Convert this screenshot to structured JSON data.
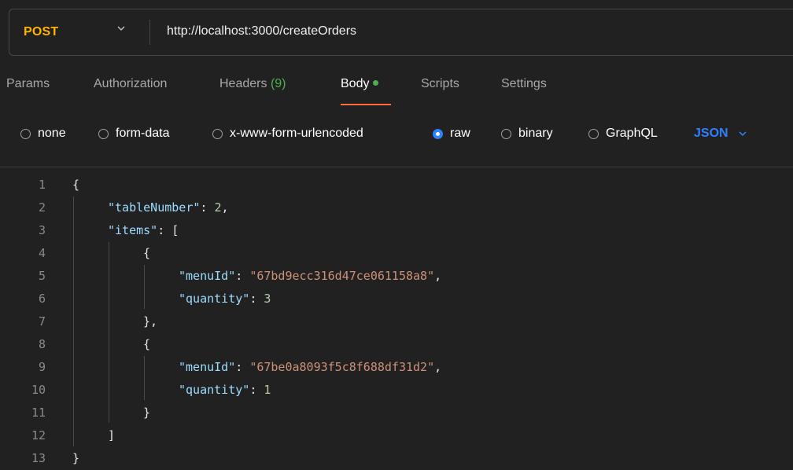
{
  "request": {
    "method": "POST",
    "url": "http://localhost:3000/createOrders"
  },
  "tabs": [
    {
      "label": "Params"
    },
    {
      "label": "Authorization"
    },
    {
      "label": "Headers",
      "count": "(9)"
    },
    {
      "label": "Body",
      "active": true
    },
    {
      "label": "Scripts"
    },
    {
      "label": "Settings"
    }
  ],
  "body_types": [
    {
      "label": "none",
      "selected": false
    },
    {
      "label": "form-data",
      "selected": false
    },
    {
      "label": "x-www-form-urlencoded",
      "selected": false
    },
    {
      "label": "raw",
      "selected": true
    },
    {
      "label": "binary",
      "selected": false
    },
    {
      "label": "GraphQL",
      "selected": false
    }
  ],
  "format": "JSON",
  "editor": {
    "line_numbers": [
      "1",
      "2",
      "3",
      "4",
      "5",
      "6",
      "7",
      "8",
      "9",
      "10",
      "11",
      "12",
      "13"
    ],
    "lines": [
      [
        {
          "t": "{",
          "c": "brace"
        }
      ],
      [
        {
          "t": "\"tableNumber\"",
          "c": "k"
        },
        {
          "t": ": ",
          "c": "p"
        },
        {
          "t": "2",
          "c": "n"
        },
        {
          "t": ",",
          "c": "p"
        }
      ],
      [
        {
          "t": "\"items\"",
          "c": "k"
        },
        {
          "t": ": [",
          "c": "p"
        }
      ],
      [
        {
          "t": "{",
          "c": "brace"
        }
      ],
      [
        {
          "t": "\"menuId\"",
          "c": "k"
        },
        {
          "t": ": ",
          "c": "p"
        },
        {
          "t": "\"67bd9ecc316d47ce061158a8\"",
          "c": "s"
        },
        {
          "t": ",",
          "c": "p"
        }
      ],
      [
        {
          "t": "\"quantity\"",
          "c": "k"
        },
        {
          "t": ": ",
          "c": "p"
        },
        {
          "t": "3",
          "c": "n"
        }
      ],
      [
        {
          "t": "},",
          "c": "brace"
        }
      ],
      [
        {
          "t": "{",
          "c": "brace"
        }
      ],
      [
        {
          "t": "\"menuId\"",
          "c": "k"
        },
        {
          "t": ": ",
          "c": "p"
        },
        {
          "t": "\"67be0a8093f5c8f688df31d2\"",
          "c": "s"
        },
        {
          "t": ",",
          "c": "p"
        }
      ],
      [
        {
          "t": "\"quantity\"",
          "c": "k"
        },
        {
          "t": ": ",
          "c": "p"
        },
        {
          "t": "1",
          "c": "n"
        }
      ],
      [
        {
          "t": "}",
          "c": "brace"
        }
      ],
      [
        {
          "t": "]",
          "c": "p"
        }
      ],
      [
        {
          "t": "}",
          "c": "brace"
        }
      ]
    ]
  },
  "colors": {
    "method": "#ffb400",
    "accent_tab": "#ff6c37",
    "status_green": "#4caf50",
    "json_blue": "#2f80ff"
  }
}
